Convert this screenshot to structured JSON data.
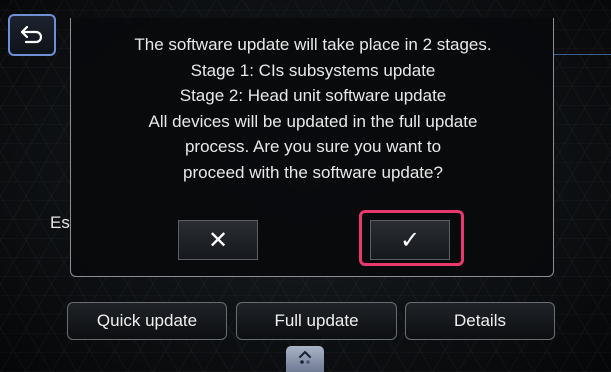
{
  "dialog": {
    "message_lines": [
      "The software update will take place in 2 stages.",
      "Stage 1: CIs subsystems update",
      "Stage 2: Head unit software update",
      "All devices will be updated in the full update",
      "process. Are you sure you want to",
      "proceed with the software update?"
    ],
    "cancel_label": "✕",
    "confirm_label": "✓"
  },
  "background": {
    "partial_label": "Es"
  },
  "bottom_bar": {
    "quick_update": "Quick update",
    "full_update": "Full update",
    "details": "Details"
  },
  "icons": {
    "back": "back-arrow-icon",
    "handle": "chevron-up-icon"
  },
  "colors": {
    "highlight": "#e8386e",
    "back_border": "#6f8fd6"
  }
}
